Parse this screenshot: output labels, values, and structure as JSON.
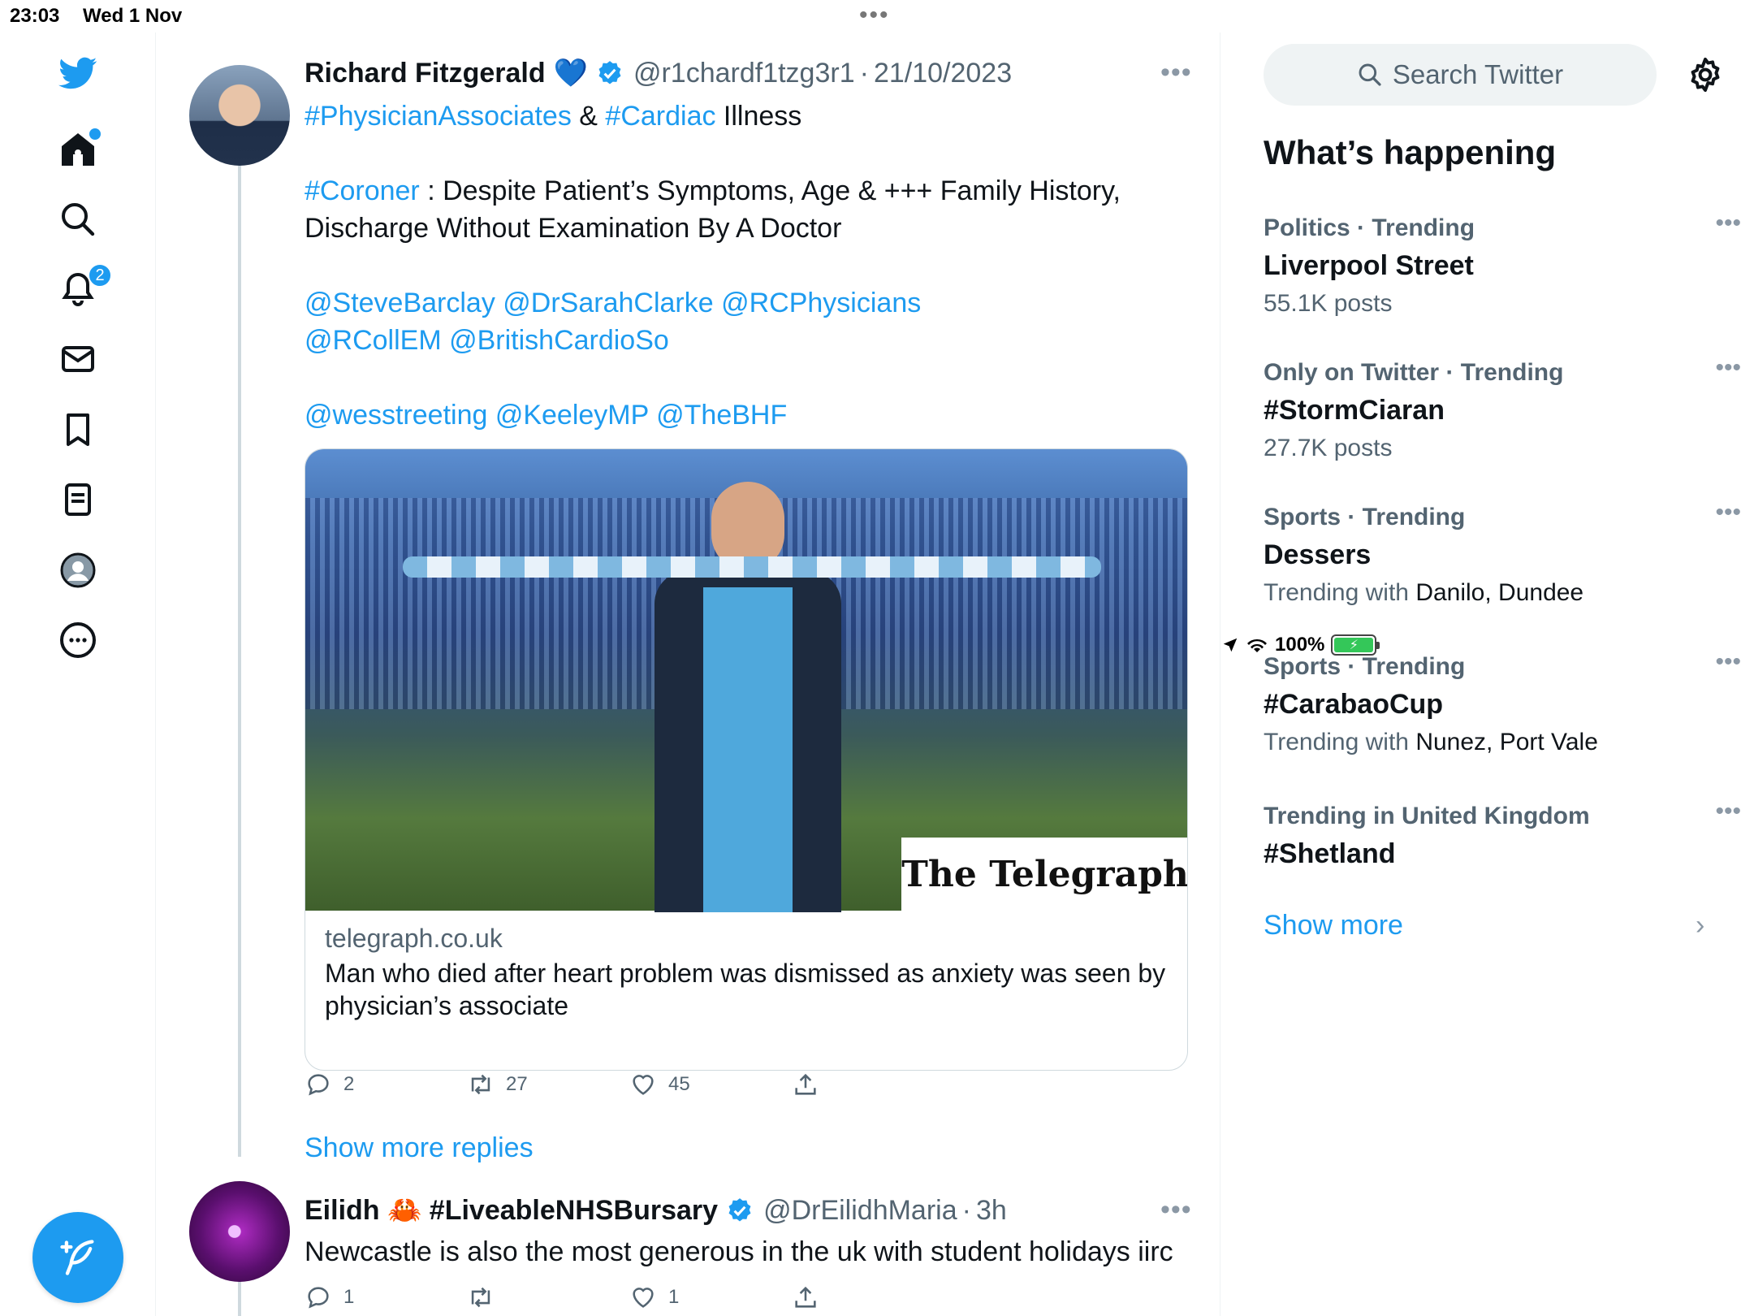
{
  "status_bar": {
    "time": "23:03",
    "date": "Wed 1 Nov",
    "battery": "100%"
  },
  "nav": {
    "notifications_badge": "2"
  },
  "tweet": {
    "name": "Richard Fitzgerald",
    "emoji": "💙",
    "handle": "@r1chardf1tzg3r1",
    "separator": "·",
    "date": "21/10/2023",
    "line1_tag1": "#PhysicianAssociates",
    "line1_mid": " & ",
    "line1_tag2": "#Cardiac",
    "line1_end": " Illness",
    "p2_tag": "#Coroner",
    "p2_text": " : Despite Patient’s Symptoms, Age & +++ Family History, Discharge Without Examination By A Doctor",
    "mentions1": "@SteveBarclay @DrSarahClarke @RCPhysicians @RCollEM @BritishCardioSo",
    "mentions2": "@wesstreeting @KeeleyMP @TheBHF",
    "card": {
      "brand": "The Telegraph",
      "domain": "telegraph.co.uk",
      "title": "Man who died after heart problem was dismissed as anxiety was seen by physician’s associate"
    },
    "replies": "2",
    "retweets": "27",
    "likes": "45"
  },
  "show_more_replies": "Show more replies",
  "reply": {
    "name": "Eilidh 🦀 #LiveableNHSBursary",
    "handle": "@DrEilidhMaria",
    "separator": "·",
    "time": "3h",
    "text": "Newcastle is also the most generous in the uk with student holidays iirc",
    "replies": "1",
    "likes": "1"
  },
  "sidebar": {
    "search_placeholder": "Search Twitter",
    "heading": "What’s happening",
    "trends": [
      {
        "context": "Politics · Trending",
        "title": "Liverpool Street",
        "sub": "55.1K posts",
        "sub_with": ""
      },
      {
        "context": "Only on Twitter · Trending",
        "title": "#StormCiaran",
        "sub": "27.7K posts",
        "sub_with": ""
      },
      {
        "context": "Sports · Trending",
        "title": "Dessers",
        "sub": "Trending with ",
        "sub_with": "Danilo, Dundee"
      },
      {
        "context": "Sports · Trending",
        "title": "#CarabaoCup",
        "sub": "Trending with ",
        "sub_with": "Nunez, Port Vale"
      },
      {
        "context": "Trending in United Kingdom",
        "title": "#Shetland",
        "sub": "",
        "sub_with": ""
      }
    ],
    "show_more": "Show more"
  },
  "colors": {
    "accent": "#1d9bf0",
    "text": "#0f1419",
    "secondary": "#536471"
  }
}
